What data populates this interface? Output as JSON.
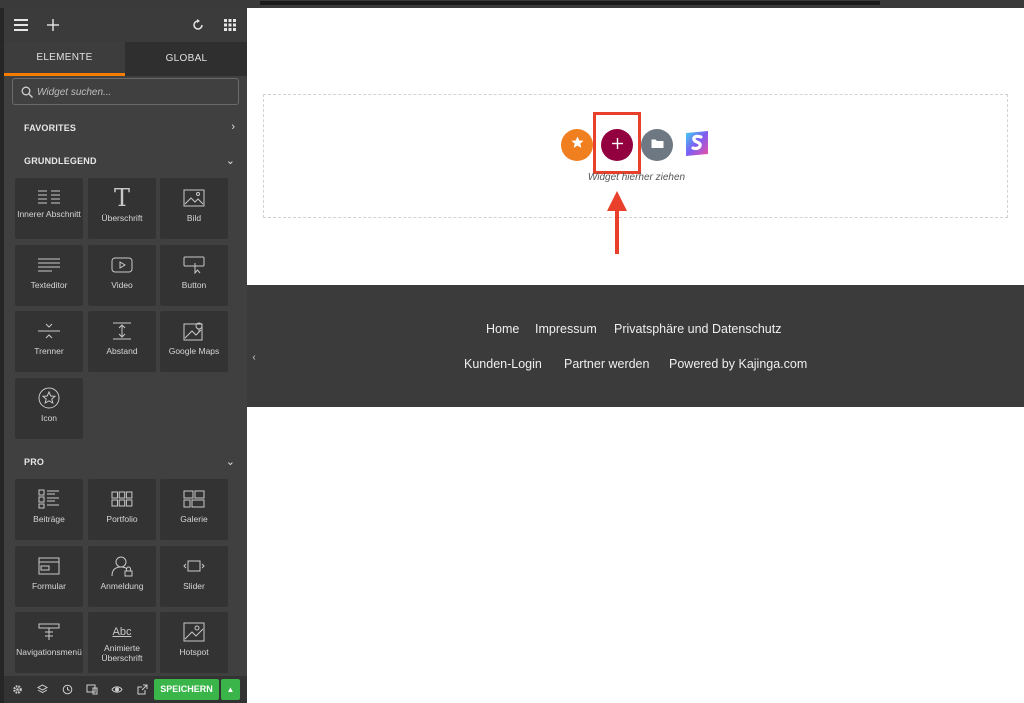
{
  "sidebar": {
    "header_icons": [
      "hamburger-icon",
      "move-icon",
      "refresh-icon",
      "grid-icon"
    ],
    "tabs": [
      {
        "label": "ELEMENTE",
        "active": true
      },
      {
        "label": "GLOBAL",
        "active": false
      }
    ],
    "search": {
      "placeholder": "Widget suchen..."
    },
    "sections": {
      "favorites": "FAVORITES",
      "basic": "GRUNDLEGEND",
      "pro": "PRO"
    },
    "basic_widgets": [
      {
        "label": "Innerer Abschnitt",
        "icon": "inner-section-icon"
      },
      {
        "label": "Überschrift",
        "icon": "heading-icon"
      },
      {
        "label": "Bild",
        "icon": "image-icon"
      },
      {
        "label": "Texteditor",
        "icon": "text-editor-icon"
      },
      {
        "label": "Video",
        "icon": "video-icon"
      },
      {
        "label": "Button",
        "icon": "button-icon"
      },
      {
        "label": "Trenner",
        "icon": "divider-icon"
      },
      {
        "label": "Abstand",
        "icon": "spacer-icon"
      },
      {
        "label": "Google Maps",
        "icon": "map-icon"
      },
      {
        "label": "Icon",
        "icon": "star-icon"
      }
    ],
    "pro_widgets": [
      {
        "label": "Beiträge",
        "icon": "posts-icon"
      },
      {
        "label": "Portfolio",
        "icon": "portfolio-icon"
      },
      {
        "label": "Galerie",
        "icon": "gallery-icon"
      },
      {
        "label": "Formular",
        "icon": "form-icon"
      },
      {
        "label": "Anmeldung",
        "icon": "login-icon"
      },
      {
        "label": "Slider",
        "icon": "slider-icon"
      },
      {
        "label": "Navigationsmenü",
        "icon": "nav-menu-icon"
      },
      {
        "label": "Animierte Überschrift",
        "icon": "animated-heading-icon"
      },
      {
        "label": "Hotspot",
        "icon": "hotspot-icon"
      }
    ],
    "footer": {
      "icons": [
        "settings-icon",
        "layers-icon",
        "history-icon",
        "responsive-icon",
        "preview-icon",
        "external-link-icon"
      ],
      "save_label": "SPEICHERN"
    }
  },
  "canvas": {
    "drop_text": "Widget hierher ziehen",
    "colors": {
      "add_star": "#f0801f",
      "add_plus": "#93003f",
      "add_folder": "#6d7882",
      "highlight": "#e8402a"
    },
    "footer_links_row1": [
      "Home",
      "Impressum",
      "Privatsphäre und Datenschutz"
    ],
    "footer_links_row2": [
      "Kunden-Login",
      "Partner werden",
      "Powered by Kajinga.com"
    ]
  }
}
